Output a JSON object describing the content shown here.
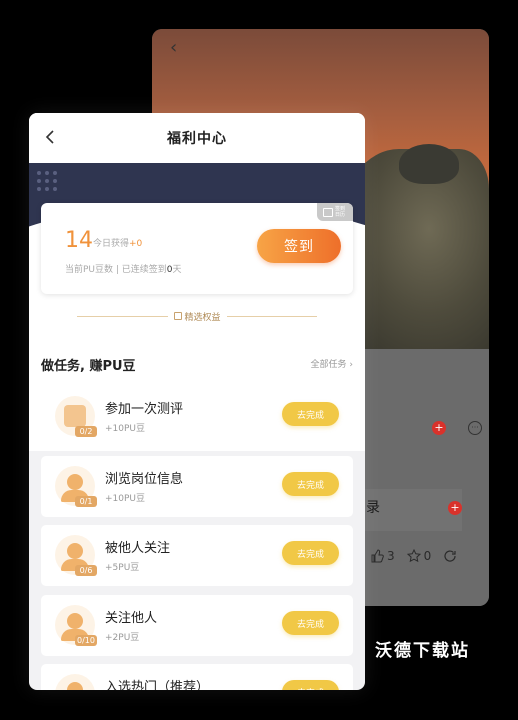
{
  "back_screen": {
    "partial_text": "录",
    "like_count": "3",
    "star_count": "0"
  },
  "watermark": "沃德下载站",
  "header": {
    "title": "福利中心"
  },
  "points": {
    "count": "14",
    "today_label": "今日获得",
    "today_gain": "+0",
    "sub_prefix": "当前PU豆数 | 已连续签到",
    "streak_days": "0",
    "sub_suffix": "天",
    "sign_in_label": "签到",
    "calendar_label": "签到日历"
  },
  "section_divider": {
    "label": "精选权益"
  },
  "tasks_section": {
    "title": "做任务, 赚PU豆",
    "all_label": "全部任务",
    "items": [
      {
        "name": "参加一次测评",
        "reward": "+10PU豆",
        "progress": "0/2",
        "action": "去完成",
        "icon": "clipboard-icon"
      },
      {
        "name": "浏览岗位信息",
        "reward": "+10PU豆",
        "progress": "0/1",
        "action": "去完成",
        "icon": "briefcase-person-icon"
      },
      {
        "name": "被他人关注",
        "reward": "+5PU豆",
        "progress": "0/6",
        "action": "去完成",
        "icon": "person-star-icon"
      },
      {
        "name": "关注他人",
        "reward": "+2PU豆",
        "progress": "0/10",
        "action": "去完成",
        "icon": "person-star-icon"
      },
      {
        "name": "入选热门（推荐）",
        "reward": "",
        "progress": "",
        "action": "去完成",
        "icon": "fire-icon"
      }
    ]
  },
  "colors": {
    "accent": "#f0923b",
    "nav_dark": "#2f3550",
    "go_button": "#f1c846"
  }
}
